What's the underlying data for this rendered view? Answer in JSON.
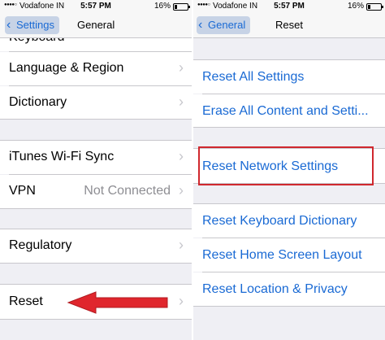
{
  "left": {
    "status": {
      "signal": "●●●●○",
      "carrier": "Vodafone IN",
      "time": "5:57 PM",
      "battery": "16%"
    },
    "nav": {
      "back_label": "Settings",
      "title": "General"
    },
    "rows": {
      "partial": "Keyboard",
      "language": "Language & Region",
      "dictionary": "Dictionary",
      "itunes": "iTunes Wi-Fi Sync",
      "vpn": "VPN",
      "vpn_value": "Not Connected",
      "regulatory": "Regulatory",
      "reset": "Reset"
    },
    "chevron": "›"
  },
  "right": {
    "status": {
      "signal": "●●●●○",
      "carrier": "Vodafone IN",
      "time": "5:57 PM",
      "battery": "16%"
    },
    "nav": {
      "back_label": "General",
      "title": "Reset"
    },
    "rows": {
      "reset_all": "Reset All Settings",
      "erase_all": "Erase All Content and Setti...",
      "reset_network": "Reset Network Settings",
      "reset_keyboard": "Reset Keyboard Dictionary",
      "reset_home": "Reset Home Screen Layout",
      "reset_location": "Reset Location & Privacy"
    }
  },
  "colors": {
    "accent": "#1a6ad4",
    "highlight": "#d0282e",
    "group_bg": "#efeff4"
  }
}
